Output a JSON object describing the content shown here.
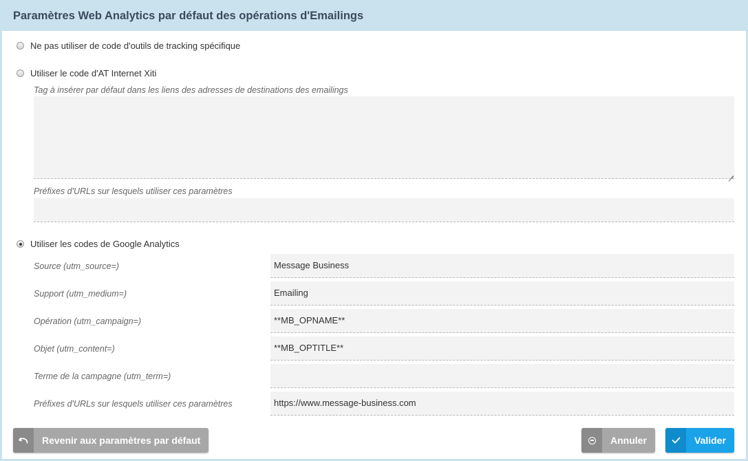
{
  "header": {
    "title": "Paramètres Web Analytics par défaut des opérations d'Emailings"
  },
  "options": {
    "none": {
      "label": "Ne pas utiliser de code d'outils de tracking spécifique",
      "checked": false
    },
    "xiti": {
      "label": "Utiliser le code d'AT Internet Xiti",
      "checked": false,
      "tag_label": "Tag à insérer par défaut dans les liens des adresses de destinations des emailings",
      "tag_value": "",
      "prefix_label": "Préfixes d'URLs sur lesquels utiliser ces paramètres",
      "prefix_value": ""
    },
    "google": {
      "label": "Utiliser les codes de Google Analytics",
      "checked": true,
      "fields": [
        {
          "label": "Source (utm_source=)",
          "value": "Message Business"
        },
        {
          "label": "Support (utm_medium=)",
          "value": "Emailing"
        },
        {
          "label": "Opération (utm_campaign=)",
          "value": "**MB_OPNAME**"
        },
        {
          "label": "Objet (utm_content=)",
          "value": "**MB_OPTITLE**"
        },
        {
          "label": "Terme de la campagne (utm_term=)",
          "value": ""
        },
        {
          "label": "Préfixes d'URLs sur lesquels utiliser ces paramètres",
          "value": "https://www.message-business.com"
        }
      ]
    }
  },
  "buttons": {
    "reset": {
      "label": "Revenir aux paramètres par défaut",
      "icon": "undo-icon"
    },
    "cancel": {
      "label": "Annuler",
      "icon": "minus-circle-icon"
    },
    "validate": {
      "label": "Valider",
      "icon": "check-icon"
    }
  },
  "colors": {
    "header_bg": "#c9e2ee",
    "primary": "#1aa3e8",
    "secondary": "#a7a7a7"
  }
}
